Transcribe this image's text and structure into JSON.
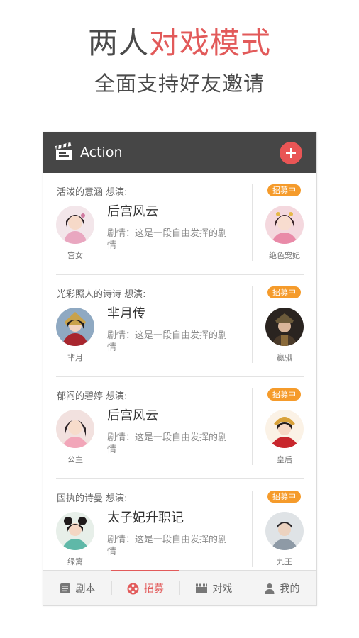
{
  "promo": {
    "title_main": "两人",
    "title_accent": "对戏模式",
    "subtitle": "全面支持好友邀请"
  },
  "app_bar": {
    "title": "Action"
  },
  "colors": {
    "accent": "#e25a5a",
    "badge": "#f59b2b",
    "app_bar": "#464646"
  },
  "list": {
    "items": [
      {
        "user_line": "活泼的意涵 想演:",
        "left_role": "宫女",
        "drama_title": "后宫风云",
        "plot": "剧情：这是一段自由发挥的剧情",
        "badge": "招募中",
        "right_role": "绝色宠妃"
      },
      {
        "user_line": "光彩照人的诗诗 想演:",
        "left_role": "芈月",
        "drama_title": "芈月传",
        "plot": "剧情：这是一段自由发挥的剧情",
        "badge": "招募中",
        "right_role": "嬴驷"
      },
      {
        "user_line": "郁闷的碧婷 想演:",
        "left_role": "公主",
        "drama_title": "后宫风云",
        "plot": "剧情：这是一段自由发挥的剧情",
        "badge": "招募中",
        "right_role": "皇后"
      },
      {
        "user_line": "固执的诗曼 想演:",
        "left_role": "绿篱",
        "drama_title": "太子妃升职记",
        "plot": "剧情：这是一段自由发挥的剧情",
        "badge": "招募中",
        "right_role": "九王"
      }
    ]
  },
  "tabs": [
    {
      "label": "剧本",
      "icon": "script-icon",
      "active": false
    },
    {
      "label": "招募",
      "icon": "film-reel-icon",
      "active": true
    },
    {
      "label": "对戏",
      "icon": "clapperboard-icon",
      "active": false
    },
    {
      "label": "我的",
      "icon": "user-icon",
      "active": false
    }
  ]
}
